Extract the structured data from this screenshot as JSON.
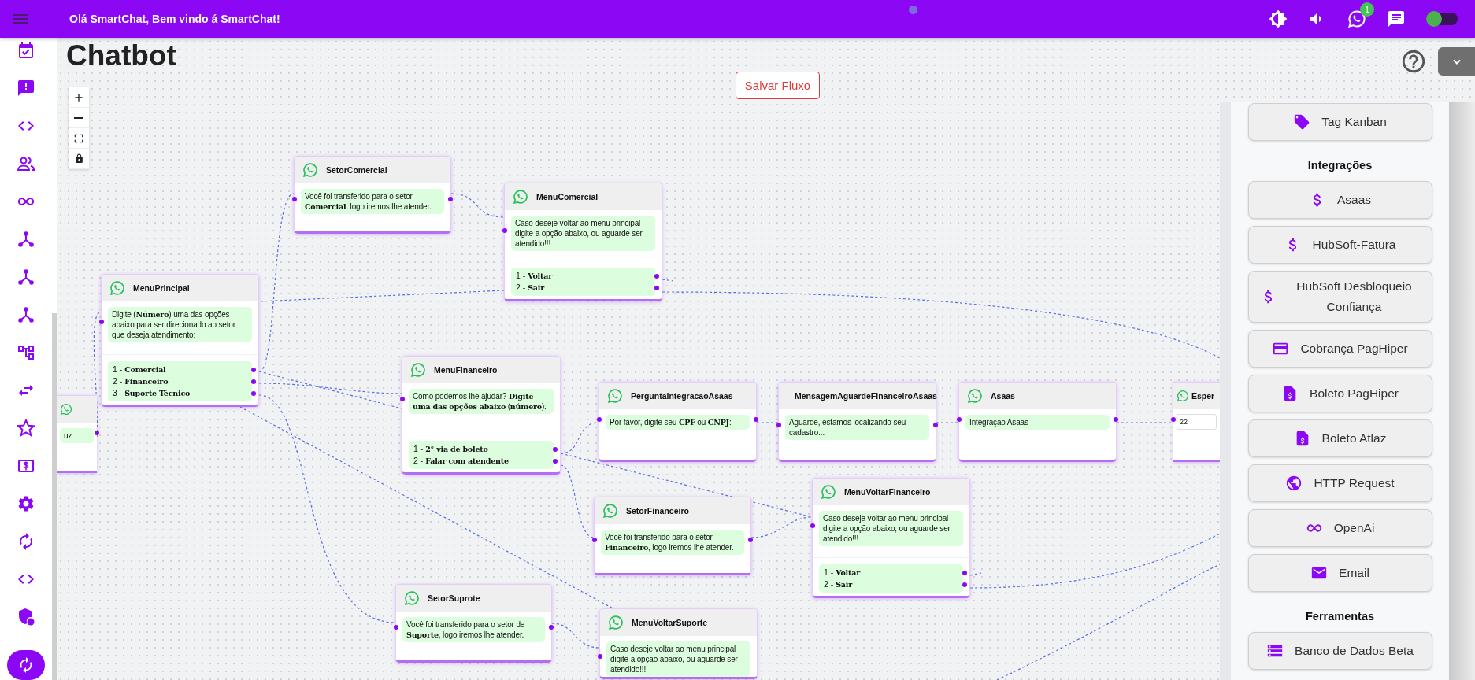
{
  "topbar": {
    "greeting": "Olá SmartChat, Bem vindo á SmartChat!",
    "notification_badge": "1",
    "theme_switch": {
      "on": true
    }
  },
  "page": {
    "title": "Chatbot",
    "save_button": "Salvar Fluxo"
  },
  "flow": {
    "nodes": [
      {
        "kind": "message",
        "title": "SetorComercial",
        "message": "Você foi transferido para o setor **Comercial**, logo iremos lhe atender."
      },
      {
        "kind": "menu",
        "title": "MenuComercial",
        "message": "Caso deseje voltar ao menu principal digite a opção abaixo, ou aguarde ser atendido!!!",
        "options": [
          "1 - **Voltar**",
          "2 - **Sair**"
        ]
      },
      {
        "kind": "menu",
        "title": "MenuPrincipal",
        "message": "Digite (**Número**) uma das opções abaixo para ser direcionado ao setor que deseja atendimento:",
        "options": [
          "1 - **Comercial**",
          "2 - **Financeiro**",
          "3 - **Suporte Técnico**"
        ]
      },
      {
        "kind": "menu",
        "title": "MenuFinanceiro",
        "message": "Como podemos lhe ajudar? **Digite uma das opções abaixo** (**número**):",
        "options": [
          "1 - **2° via de boleto**",
          "2 - **Falar com atendente**"
        ]
      },
      {
        "kind": "message",
        "title": "PerguntaIntegracaoAsaas",
        "message": "Por favor, digite seu **CPF** ou **CNPJ**:"
      },
      {
        "kind": "message",
        "title": "MensagemAguardeFinanceiroAsaas",
        "message": "Aguarde, estamos localizando seu cadastro..."
      },
      {
        "kind": "message",
        "title": "Asaas",
        "message": "Integração Asaas"
      },
      {
        "kind": "input",
        "title": "Esper",
        "value": "22"
      },
      {
        "kind": "message",
        "message": "uz"
      },
      {
        "kind": "message",
        "title": "SetorFinanceiro",
        "message": "Você foi transferido para o setor **Financeiro**, logo iremos lhe atender."
      },
      {
        "kind": "menu",
        "title": "MenuVoltarFinanceiro",
        "message": "Caso deseje voltar ao menu principal digite a opção abaixo, ou aguarde ser atendido!!!",
        "options": [
          "1 - **Voltar**",
          "2 - **Sair**"
        ]
      },
      {
        "kind": "message",
        "title": "SetorSuprote",
        "message": "Você foi transferido para o setor de **Suporte**, logo iremos lhe atender."
      },
      {
        "kind": "message",
        "title": "MenuVoltarSuporte",
        "message": "Caso deseje voltar ao menu principal digite a opção abaixo, ou aguarde ser atendido!!!"
      }
    ]
  },
  "panel": {
    "top_items": [
      "Tag Kanban"
    ],
    "sections": [
      {
        "heading": "Integrações",
        "items": [
          "Asaas",
          "HubSoft-Fatura",
          "HubSoft Desbloqueio Confiança",
          "Cobrança PagHiper",
          "Boleto PagHiper",
          "Boleto Atlaz",
          "HTTP Request",
          "OpenAi",
          "Email"
        ]
      },
      {
        "heading": "Ferramentas",
        "items": [
          "Banco de Dados Beta"
        ]
      }
    ]
  }
}
